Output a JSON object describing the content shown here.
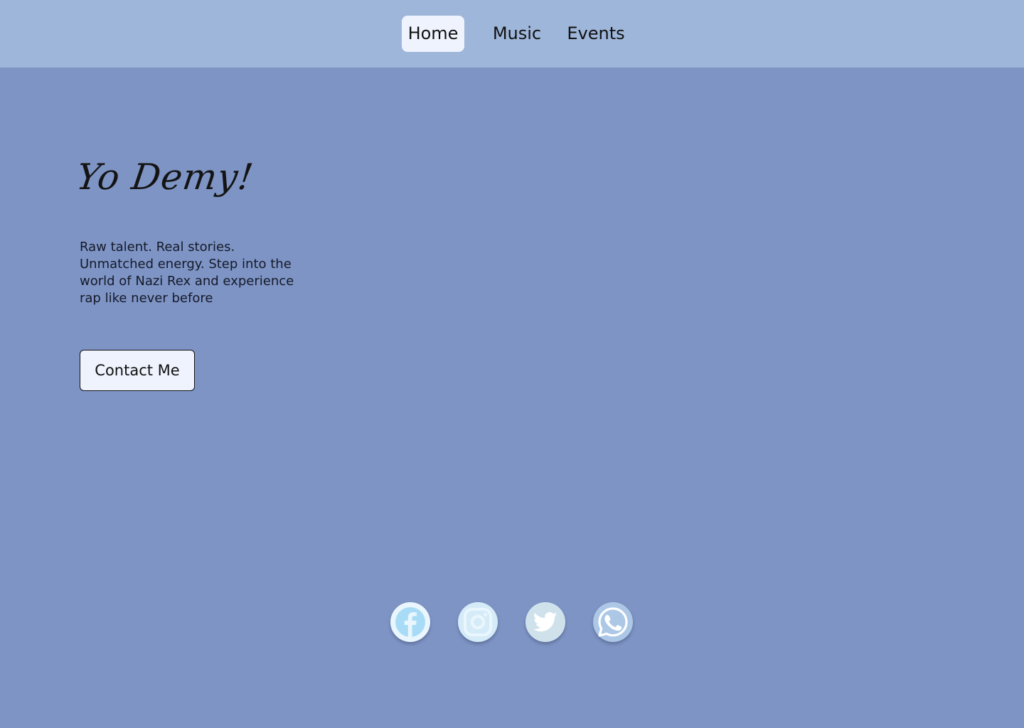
{
  "nav": {
    "items": [
      {
        "label": "Home",
        "active": true
      },
      {
        "label": "Music",
        "active": false
      },
      {
        "label": "Events",
        "active": false
      }
    ]
  },
  "hero": {
    "title": "Yo Demy!",
    "description": "Raw talent. Real stories. Unmatched energy. Step into the world of Nazi Rex and experience rap like never before",
    "contact_label": "Contact Me"
  },
  "social": [
    {
      "icon": "facebook-icon"
    },
    {
      "icon": "instagram-icon"
    },
    {
      "icon": "twitter-icon"
    },
    {
      "icon": "whatsapp-icon"
    }
  ],
  "colors": {
    "background": "#7e94c4",
    "nav_background": "#9eb6d9",
    "active_tab": "#eef3fd"
  }
}
